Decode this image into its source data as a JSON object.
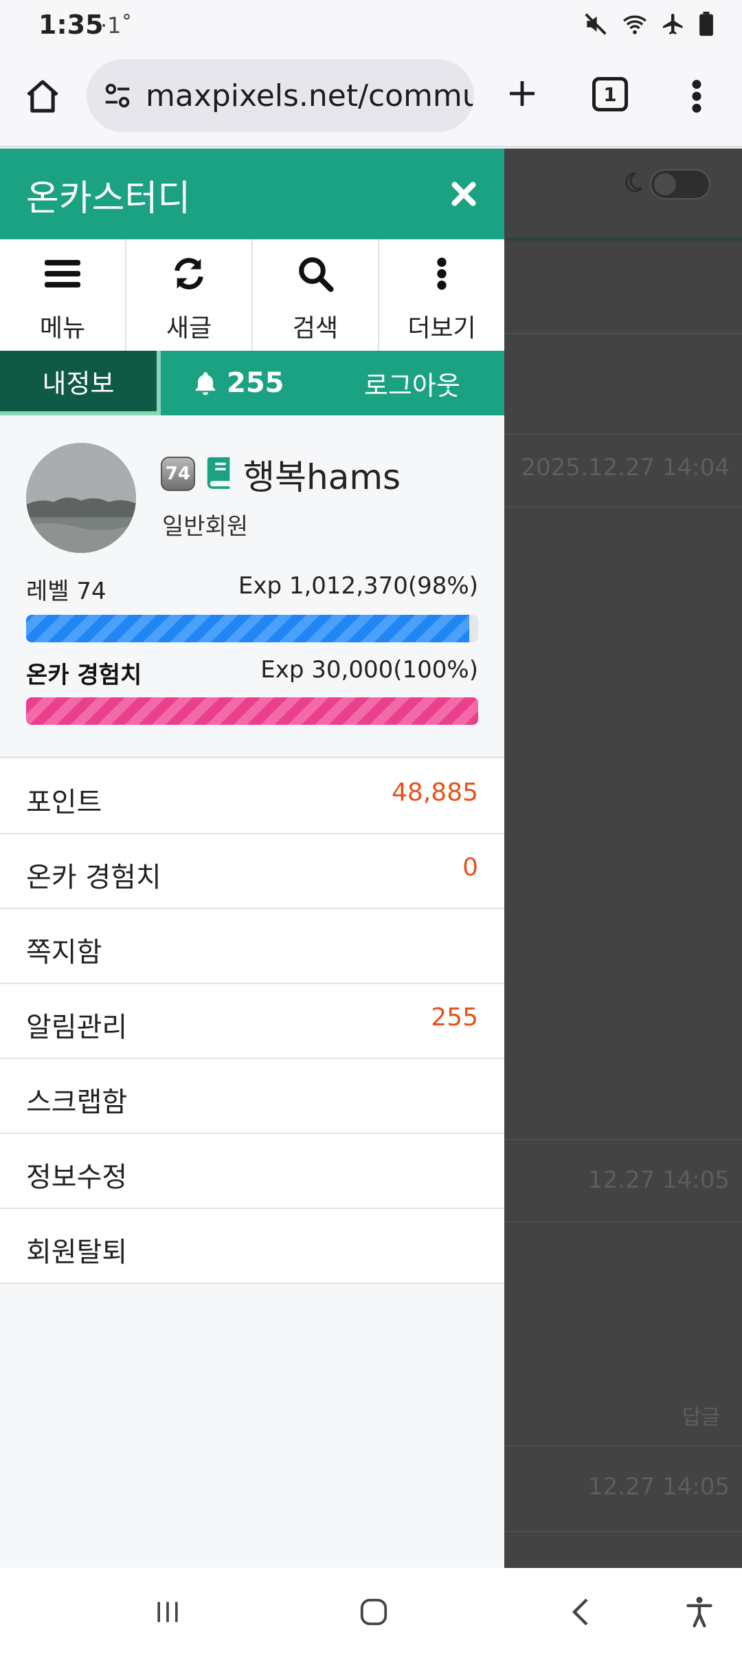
{
  "status": {
    "time": "1:35",
    "sub": "·1˚"
  },
  "browser": {
    "url": "maxpixels.net/commu",
    "tab_count": "1"
  },
  "background_page": {
    "dates": [
      "2025.12.27 14:04",
      "12.27 14:05",
      "12.27 14:05"
    ],
    "reply_label": "답글"
  },
  "drawer": {
    "title": "온카스터디",
    "quick": [
      {
        "label": "메뉴",
        "icon": "menu-icon"
      },
      {
        "label": "새글",
        "icon": "refresh-icon"
      },
      {
        "label": "검색",
        "icon": "search-icon"
      },
      {
        "label": "더보기",
        "icon": "more-vertical-icon"
      }
    ],
    "tabs": {
      "mine": "내정보",
      "notifications": "255",
      "logout": "로그아웃"
    },
    "profile": {
      "level_badge": "74",
      "username": "행복hams",
      "grade": "일반회원",
      "level_label": "레벨 74",
      "level_exp": "Exp 1,012,370(98%)",
      "level_progress": 0.98,
      "onka_label": "온카 경험치",
      "onka_exp": "Exp 30,000(100%)",
      "onka_progress": 1.0
    },
    "menu": [
      {
        "label": "포인트",
        "value": "48,885"
      },
      {
        "label": "온카 경험치",
        "value": "0"
      },
      {
        "label": "쪽지함",
        "value": ""
      },
      {
        "label": "알림관리",
        "value": "255"
      },
      {
        "label": "스크랩함",
        "value": ""
      },
      {
        "label": "정보수정",
        "value": ""
      },
      {
        "label": "회원탈퇴",
        "value": ""
      }
    ]
  },
  "colors": {
    "brand": "#1ba283",
    "brand_dark": "#0f5a45",
    "accent_value": "#e8501c",
    "bar_blue": "#1f86f4",
    "bar_pink": "#ea3f8d"
  }
}
